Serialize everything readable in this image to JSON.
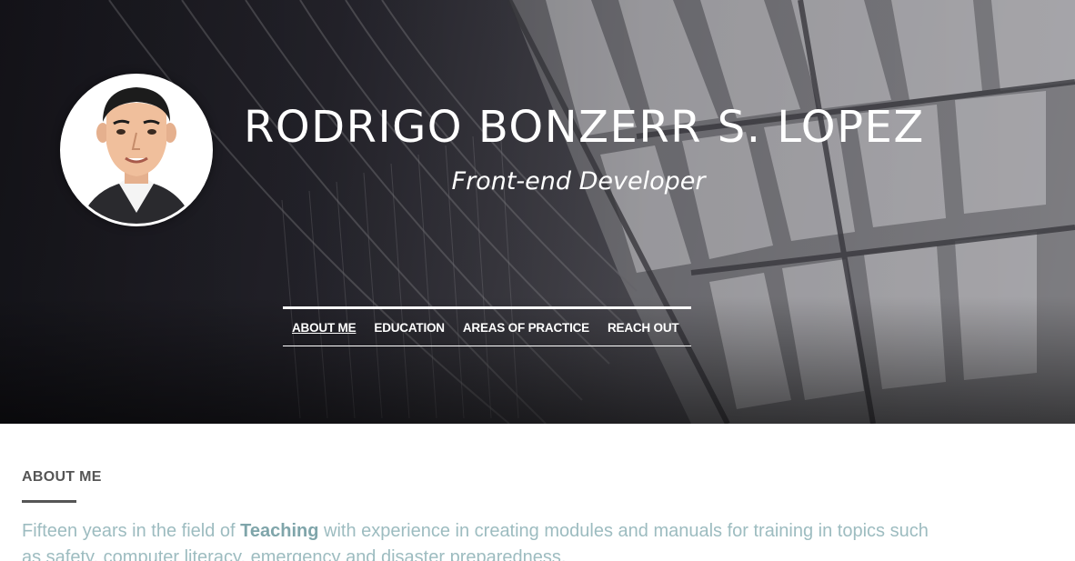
{
  "header": {
    "name": "RODRIGO BONZERR S. LOPEZ",
    "role": "Front-end Developer",
    "avatar_icon": "developer-avatar-icon"
  },
  "nav": {
    "items": [
      {
        "label": "ABOUT ME",
        "active": true
      },
      {
        "label": "EDUCATION",
        "active": false
      },
      {
        "label": "AREAS OF PRACTICE",
        "active": false
      },
      {
        "label": "REACH OUT",
        "active": false
      }
    ]
  },
  "about": {
    "title": "ABOUT ME",
    "text_before": "Fifteen years in the field of ",
    "text_bold": "Teaching",
    "text_after": " with experience in creating modules and manuals for training in topics such as safety, computer literacy, emergency and disaster preparedness."
  },
  "colors": {
    "hero_dark": "#1d1c24",
    "nav_text": "#ffffff",
    "section_title": "#555555",
    "body_text": "#9dbcc0"
  }
}
